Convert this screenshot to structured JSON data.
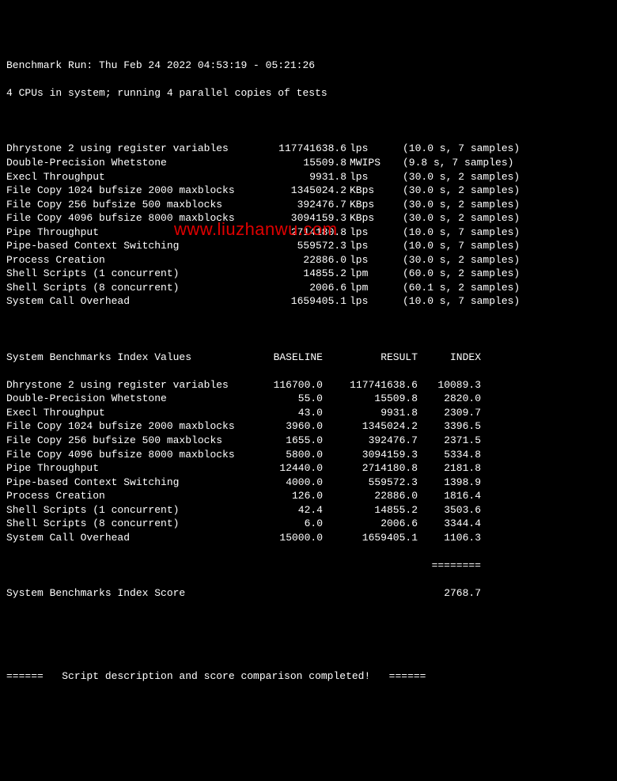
{
  "header": {
    "run_line": "Benchmark Run: Thu Feb 24 2022 04:53:19 - 05:21:26",
    "cpu_line": "4 CPUs in system; running 4 parallel copies of tests"
  },
  "results": [
    {
      "name": "Dhrystone 2 using register variables",
      "value": "117741638.6",
      "unit": "lps",
      "timing": "(10.0 s, 7 samples)"
    },
    {
      "name": "Double-Precision Whetstone",
      "value": "15509.8",
      "unit": "MWIPS",
      "timing": "(9.8 s, 7 samples)"
    },
    {
      "name": "Execl Throughput",
      "value": "9931.8",
      "unit": "lps",
      "timing": "(30.0 s, 2 samples)"
    },
    {
      "name": "File Copy 1024 bufsize 2000 maxblocks",
      "value": "1345024.2",
      "unit": "KBps",
      "timing": "(30.0 s, 2 samples)"
    },
    {
      "name": "File Copy 256 bufsize 500 maxblocks",
      "value": "392476.7",
      "unit": "KBps",
      "timing": "(30.0 s, 2 samples)"
    },
    {
      "name": "File Copy 4096 bufsize 8000 maxblocks",
      "value": "3094159.3",
      "unit": "KBps",
      "timing": "(30.0 s, 2 samples)"
    },
    {
      "name": "Pipe Throughput",
      "value": "2714180.8",
      "unit": "lps",
      "timing": "(10.0 s, 7 samples)"
    },
    {
      "name": "Pipe-based Context Switching",
      "value": "559572.3",
      "unit": "lps",
      "timing": "(10.0 s, 7 samples)"
    },
    {
      "name": "Process Creation",
      "value": "22886.0",
      "unit": "lps",
      "timing": "(30.0 s, 2 samples)"
    },
    {
      "name": "Shell Scripts (1 concurrent)",
      "value": "14855.2",
      "unit": "lpm",
      "timing": "(60.0 s, 2 samples)"
    },
    {
      "name": "Shell Scripts (8 concurrent)",
      "value": "2006.6",
      "unit": "lpm",
      "timing": "(60.1 s, 2 samples)"
    },
    {
      "name": "System Call Overhead",
      "value": "1659405.1",
      "unit": "lps",
      "timing": "(10.0 s, 7 samples)"
    }
  ],
  "index_header": {
    "title": "System Benchmarks Index Values",
    "col_baseline": "BASELINE",
    "col_result": "RESULT",
    "col_index": "INDEX"
  },
  "index": [
    {
      "name": "Dhrystone 2 using register variables",
      "baseline": "116700.0",
      "result": "117741638.6",
      "index": "10089.3"
    },
    {
      "name": "Double-Precision Whetstone",
      "baseline": "55.0",
      "result": "15509.8",
      "index": "2820.0"
    },
    {
      "name": "Execl Throughput",
      "baseline": "43.0",
      "result": "9931.8",
      "index": "2309.7"
    },
    {
      "name": "File Copy 1024 bufsize 2000 maxblocks",
      "baseline": "3960.0",
      "result": "1345024.2",
      "index": "3396.5"
    },
    {
      "name": "File Copy 256 bufsize 500 maxblocks",
      "baseline": "1655.0",
      "result": "392476.7",
      "index": "2371.5"
    },
    {
      "name": "File Copy 4096 bufsize 8000 maxblocks",
      "baseline": "5800.0",
      "result": "3094159.3",
      "index": "5334.8"
    },
    {
      "name": "Pipe Throughput",
      "baseline": "12440.0",
      "result": "2714180.8",
      "index": "2181.8"
    },
    {
      "name": "Pipe-based Context Switching",
      "baseline": "4000.0",
      "result": "559572.3",
      "index": "1398.9"
    },
    {
      "name": "Process Creation",
      "baseline": "126.0",
      "result": "22886.0",
      "index": "1816.4"
    },
    {
      "name": "Shell Scripts (1 concurrent)",
      "baseline": "42.4",
      "result": "14855.2",
      "index": "3503.6"
    },
    {
      "name": "Shell Scripts (8 concurrent)",
      "baseline": "6.0",
      "result": "2006.6",
      "index": "3344.4"
    },
    {
      "name": "System Call Overhead",
      "baseline": "15000.0",
      "result": "1659405.1",
      "index": "1106.3"
    }
  ],
  "score": {
    "rule": "========",
    "label": "System Benchmarks Index Score",
    "value": "2768.7"
  },
  "footer": {
    "line": "======   Script description and score comparison completed!   ======"
  },
  "watermark": "www.liuzhanwu.com"
}
